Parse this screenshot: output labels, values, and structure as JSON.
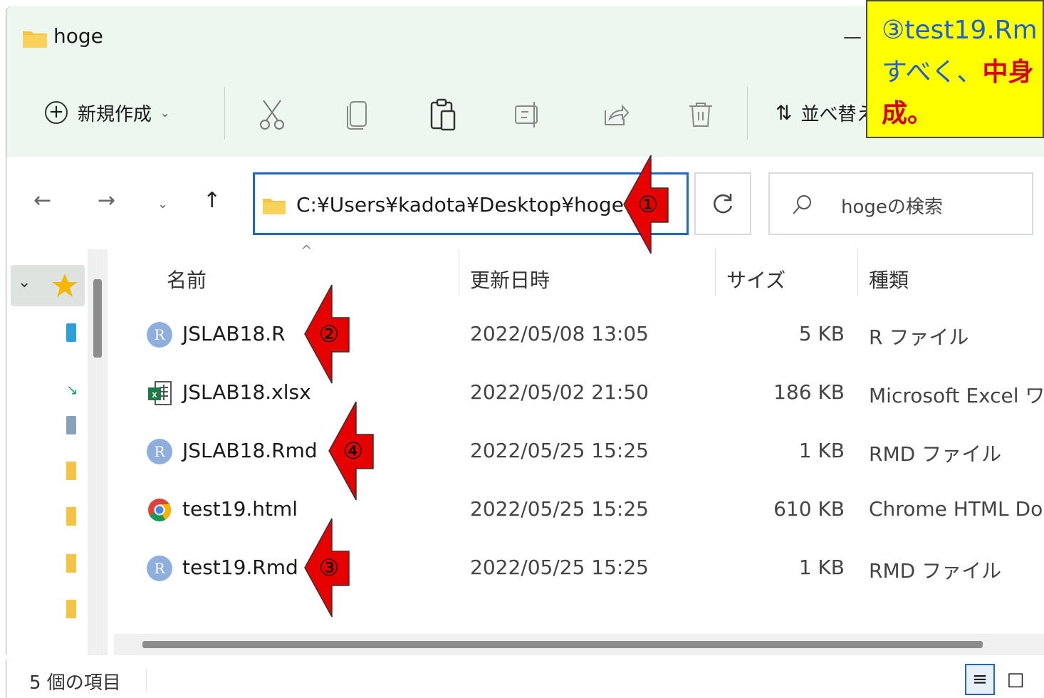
{
  "window": {
    "title": "hoge",
    "minimize_glyph": "—"
  },
  "commandbar": {
    "new_label": "新規作成",
    "new_chevron": "⌄",
    "sort_label": "並べ替え",
    "icons": [
      "cut-icon",
      "copy-icon",
      "paste-icon",
      "rename-icon",
      "share-icon",
      "delete-icon"
    ]
  },
  "nav": {
    "back": "←",
    "forward": "→",
    "recent": "⌄",
    "up": "↑"
  },
  "address": {
    "path": "C:¥Users¥kadota¥Desktop¥hoge"
  },
  "search": {
    "placeholder": "hogeの検索"
  },
  "columns": {
    "name": "名前",
    "modified": "更新日時",
    "size": "サイズ",
    "type": "種類",
    "sort_caret": "^"
  },
  "files": [
    {
      "name": "JSLAB18.R",
      "modified": "2022/05/08 13:05",
      "size": "5 KB",
      "type": "R ファイル",
      "icon": "r-file-icon"
    },
    {
      "name": "JSLAB18.xlsx",
      "modified": "2022/05/02 21:50",
      "size": "186 KB",
      "type": "Microsoft Excel ワ...",
      "icon": "excel-file-icon"
    },
    {
      "name": "JSLAB18.Rmd",
      "modified": "2022/05/25 15:25",
      "size": "1 KB",
      "type": "RMD ファイル",
      "icon": "r-file-icon"
    },
    {
      "name": "test19.html",
      "modified": "2022/05/25 15:25",
      "size": "610 KB",
      "type": "Chrome HTML Do...",
      "icon": "chrome-file-icon"
    },
    {
      "name": "test19.Rmd",
      "modified": "2022/05/25 15:25",
      "size": "1 KB",
      "type": "RMD ファイル",
      "icon": "r-file-icon"
    }
  ],
  "status": {
    "item_count": "5 個の項目"
  },
  "callout": {
    "line1": "③test19.Rm",
    "line2_blue": "すべく、",
    "line2_red": "中身",
    "line3": "成。"
  },
  "markers": [
    {
      "label": "①",
      "points_to": "address-bar"
    },
    {
      "label": "②",
      "points_to": "JSLAB18.R"
    },
    {
      "label": "④",
      "points_to": "JSLAB18.Rmd"
    },
    {
      "label": "③",
      "points_to": "test19.Rmd"
    }
  ],
  "colors": {
    "accent": "#1e66c9",
    "command_bar_bg": "#edf6ef",
    "callout_bg": "#ffff00",
    "marker_red": "#e60000",
    "folder_yellow": "#f6c343"
  }
}
